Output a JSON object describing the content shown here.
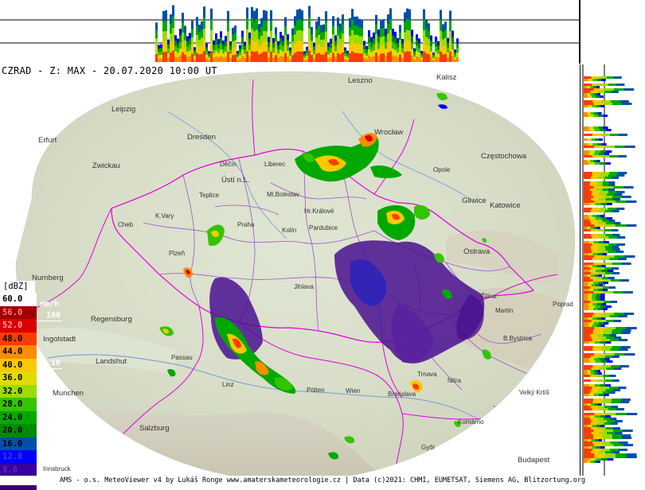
{
  "title": "CZRAD - Z: MAX - 20.07.2020 10:00 UT",
  "footer": "AMS - o.s. MeteoViewer v4 by Lukáš Ronge www.amaterskameteorologie.cz | Data (c)2021: CHMI, EUMETSAT, Siemens AG, Blitzortung.org",
  "legend": {
    "unit_dbz": "[dBZ]",
    "unit_mmh": "mm/h",
    "levels": [
      {
        "value": "60.0",
        "color": "#ffffff",
        "text_color": "#000000"
      },
      {
        "value": "56.0",
        "color": "#a00000",
        "text_color": "#ff8080"
      },
      {
        "value": "52.0",
        "color": "#dc0000",
        "text_color": "#ffa0a0"
      },
      {
        "value": "48.0",
        "color": "#fc3c00",
        "text_color": "#000000"
      },
      {
        "value": "44.0",
        "color": "#fc8c00",
        "text_color": "#000000"
      },
      {
        "value": "40.0",
        "color": "#fcc800",
        "text_color": "#000000"
      },
      {
        "value": "36.0",
        "color": "#e0dc00",
        "text_color": "#000000"
      },
      {
        "value": "32.0",
        "color": "#9cdc00",
        "text_color": "#000000"
      },
      {
        "value": "28.0",
        "color": "#34c400",
        "text_color": "#000000"
      },
      {
        "value": "24.0",
        "color": "#00a800",
        "text_color": "#000000"
      },
      {
        "value": "20.0",
        "color": "#008c00",
        "text_color": "#000000"
      },
      {
        "value": "16.0",
        "color": "#0050a8",
        "text_color": "#000000"
      },
      {
        "value": "12.0",
        "color": "#0000fc",
        "text_color": "#3838ff"
      },
      {
        "value": "8.0",
        "color": "#3800a0",
        "text_color": "#5030c0"
      },
      {
        "value": "4.0",
        "color": "#380070",
        "text_color": "#5030c0"
      }
    ],
    "mmh_labels": [
      "100",
      "10",
      "1",
      "0.1"
    ]
  },
  "cities": [
    {
      "name": "Leszno"
    },
    {
      "name": "Kalisz"
    },
    {
      "name": "Leipzig"
    },
    {
      "name": "Wrocław"
    },
    {
      "name": "Erfurt"
    },
    {
      "name": "Dresden"
    },
    {
      "name": "Częstochowa"
    },
    {
      "name": "Zwickau"
    },
    {
      "name": "Děčín"
    },
    {
      "name": "Liberec"
    },
    {
      "name": "Opole"
    },
    {
      "name": "Ústí n.L."
    },
    {
      "name": "Ml.Boleslav"
    },
    {
      "name": "Teplice"
    },
    {
      "name": "Gliwice"
    },
    {
      "name": "Katowice"
    },
    {
      "name": "K.Vary"
    },
    {
      "name": "Hr.Králové"
    },
    {
      "name": "Praha"
    },
    {
      "name": "Cheb"
    },
    {
      "name": "Kolín"
    },
    {
      "name": "Pardubice"
    },
    {
      "name": "Plzeň"
    },
    {
      "name": "Ostrava"
    },
    {
      "name": "Nurnberg"
    },
    {
      "name": "Jihlava"
    },
    {
      "name": "Žilina"
    },
    {
      "name": "Poprad"
    },
    {
      "name": "Regensburg"
    },
    {
      "name": "Martin"
    },
    {
      "name": "Ingolstadt"
    },
    {
      "name": "B.Bystrica"
    },
    {
      "name": "Passau"
    },
    {
      "name": "Landshut"
    },
    {
      "name": "Nitra"
    },
    {
      "name": "Linz"
    },
    {
      "name": "Pölten"
    },
    {
      "name": "Wien"
    },
    {
      "name": "Munchen"
    },
    {
      "name": "Bratislava"
    },
    {
      "name": "Velký Krtíš"
    },
    {
      "name": "Komárno"
    },
    {
      "name": "Salzburg"
    },
    {
      "name": "Győr"
    },
    {
      "name": "Budapest"
    },
    {
      "name": "Innsbruck"
    },
    {
      "name": "Trnava"
    }
  ]
}
